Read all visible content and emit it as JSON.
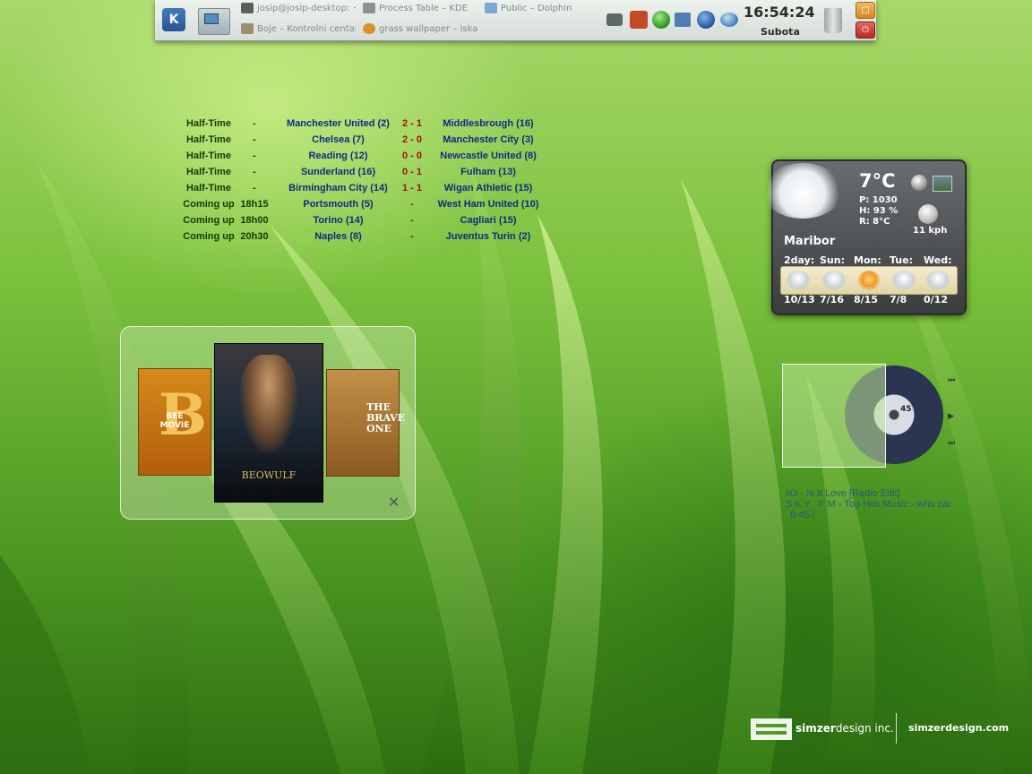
{
  "panel": {
    "k_menu": "K",
    "tasks": [
      {
        "label": "josip@josip-desktop: ~"
      },
      {
        "label": "Process Table – KDE"
      },
      {
        "label": "Public – Dolphin"
      },
      {
        "label": "Boje – Kontrolni centar"
      },
      {
        "label": "grass wallpaper – Iskanje"
      }
    ],
    "clock": "16:54:24",
    "date": "Subota",
    "colors": {
      "accent": "#1c4a96"
    }
  },
  "football": {
    "matches": [
      {
        "status": "Half-Time",
        "time": "-",
        "home": "Manchester United (2)",
        "score": "2 - 1",
        "away": "Middlesbrough (16)"
      },
      {
        "status": "Half-Time",
        "time": "-",
        "home": "Chelsea (7)",
        "score": "2 - 0",
        "away": "Manchester City (3)"
      },
      {
        "status": "Half-Time",
        "time": "-",
        "home": "Reading (12)",
        "score": "0 - 0",
        "away": "Newcastle United (8)"
      },
      {
        "status": "Half-Time",
        "time": "-",
        "home": "Sunderland (16)",
        "score": "0 - 1",
        "away": "Fulham (13)"
      },
      {
        "status": "Half-Time",
        "time": "-",
        "home": "Birmingham City (14)",
        "score": "1 - 1",
        "away": "Wigan Athletic (15)"
      },
      {
        "status": "Coming up",
        "time": "18h15",
        "home": "Portsmouth (5)",
        "score": "-",
        "away": "West Ham United (10)"
      },
      {
        "status": "Coming up",
        "time": "18h00",
        "home": "Torino (14)",
        "score": "-",
        "away": "Cagliari (15)"
      },
      {
        "status": "Coming up",
        "time": "20h30",
        "home": "Naples (8)",
        "score": "-",
        "away": "Juventus Turin (2)"
      }
    ]
  },
  "weather": {
    "temp": "7°C",
    "pressure": "P: 1030",
    "humidity": "H: 93 %",
    "realfeel": "R: 8°C",
    "wind": "11 kph",
    "city": "Maribor",
    "forecast": [
      {
        "day": "2day:",
        "temps": "10/13",
        "icon": "cloud-rain-icon"
      },
      {
        "day": "Sun:",
        "temps": "7/16",
        "icon": "cloud-rain-icon"
      },
      {
        "day": "Mon:",
        "temps": "8/15",
        "icon": "sun-cloud-icon"
      },
      {
        "day": "Tue:",
        "temps": "7/8",
        "icon": "cloud-storm-icon"
      },
      {
        "day": "Wed:",
        "temps": "0/12",
        "icon": "cloud-rain-icon"
      }
    ]
  },
  "media": {
    "bee_movie": "BEE MOVIE",
    "beowulf": "BEOWULF",
    "brave_one": "THE BRAVE ONE"
  },
  "player": {
    "line1": "iiO - Is It Love [Radio Edit]",
    "line2": "S K Y . F M - Top Hits Music - who car",
    "line3": "8:45 /",
    "disc_label": "45"
  },
  "brand": {
    "name_bold": "simzer",
    "name_rest": "design inc.",
    "url": "simzerdesign.com"
  }
}
